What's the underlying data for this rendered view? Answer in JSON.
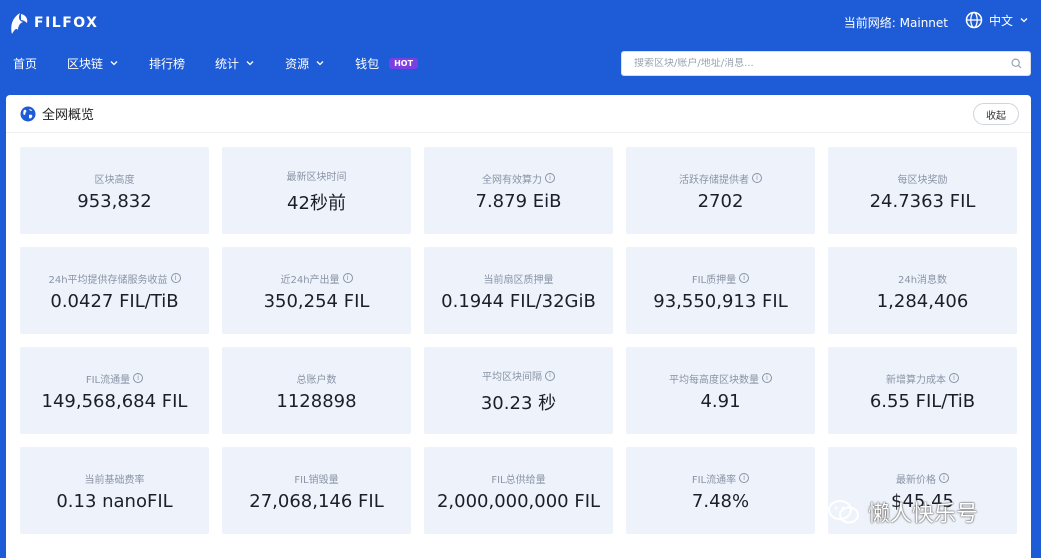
{
  "brand": {
    "name": "FILFOX"
  },
  "header": {
    "network_label": "当前网络: Mainnet",
    "language": "中文"
  },
  "nav": [
    {
      "label": "首页",
      "dropdown": false
    },
    {
      "label": "区块链",
      "dropdown": true
    },
    {
      "label": "排行榜",
      "dropdown": false
    },
    {
      "label": "统计",
      "dropdown": true
    },
    {
      "label": "资源",
      "dropdown": true
    },
    {
      "label": "钱包",
      "dropdown": false,
      "badge": "HOT"
    }
  ],
  "search": {
    "placeholder": "搜索区块/账户/地址/消息..."
  },
  "panel": {
    "title": "全网概览",
    "collapse_label": "收起"
  },
  "stats": [
    {
      "label": "区块高度",
      "value": "953,832",
      "info": false
    },
    {
      "label": "最新区块时间",
      "value": "42秒前",
      "info": false
    },
    {
      "label": "全网有效算力",
      "value": "7.879 EiB",
      "info": true
    },
    {
      "label": "活跃存储提供者",
      "value": "2702",
      "info": true
    },
    {
      "label": "每区块奖励",
      "value": "24.7363 FIL",
      "info": false
    },
    {
      "label": "24h平均提供存储服务收益",
      "value": "0.0427 FIL/TiB",
      "info": true
    },
    {
      "label": "近24h产出量",
      "value": "350,254 FIL",
      "info": true
    },
    {
      "label": "当前扇区质押量",
      "value": "0.1944 FIL/32GiB",
      "info": false
    },
    {
      "label": "FIL质押量",
      "value": "93,550,913 FIL",
      "info": true
    },
    {
      "label": "24h消息数",
      "value": "1,284,406",
      "info": false
    },
    {
      "label": "FIL流通量",
      "value": "149,568,684 FIL",
      "info": true
    },
    {
      "label": "总账户数",
      "value": "1128898",
      "info": false
    },
    {
      "label": "平均区块间隔",
      "value": "30.23 秒",
      "info": true
    },
    {
      "label": "平均每高度区块数量",
      "value": "4.91",
      "info": true
    },
    {
      "label": "新增算力成本",
      "value": "6.55 FIL/TiB",
      "info": true
    },
    {
      "label": "当前基础费率",
      "value": "0.13 nanoFIL",
      "info": false
    },
    {
      "label": "FIL销毁量",
      "value": "27,068,146 FIL",
      "info": false
    },
    {
      "label": "FIL总供给量",
      "value": "2,000,000,000 FIL",
      "info": false
    },
    {
      "label": "FIL流通率",
      "value": "7.48%",
      "info": true
    },
    {
      "label": "最新价格",
      "value": "$45.45",
      "info": true
    }
  ],
  "watermark": {
    "text": "懒人快乐号"
  }
}
